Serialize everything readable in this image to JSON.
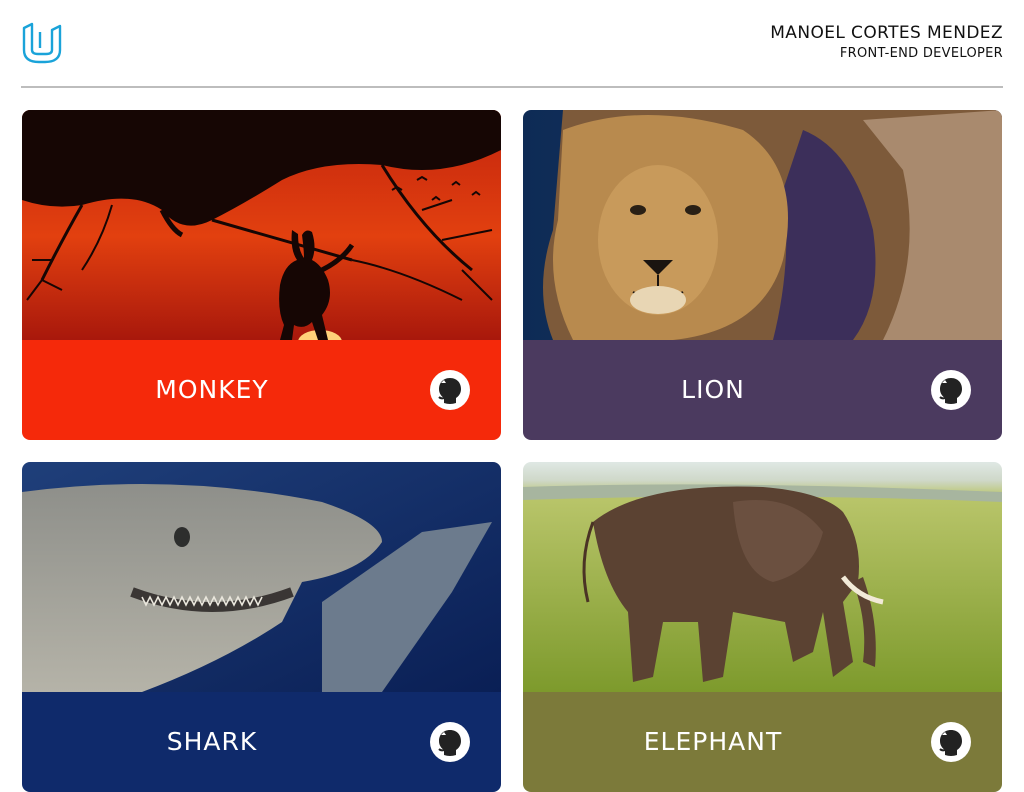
{
  "header": {
    "logo_icon": "udacity-logo-icon",
    "name": "MANOEL CORTES MENDEZ",
    "role": "FRONT-END DEVELOPER"
  },
  "cards": [
    {
      "title": "MONKEY",
      "color": "#f5290a",
      "icon": "github-icon"
    },
    {
      "title": "LION",
      "color": "#4b3a5f",
      "icon": "github-icon"
    },
    {
      "title": "SHARK",
      "color": "#0f2a6b",
      "icon": "github-icon"
    },
    {
      "title": "ELEPHANT",
      "color": "#7c7a3a",
      "icon": "github-icon"
    }
  ]
}
